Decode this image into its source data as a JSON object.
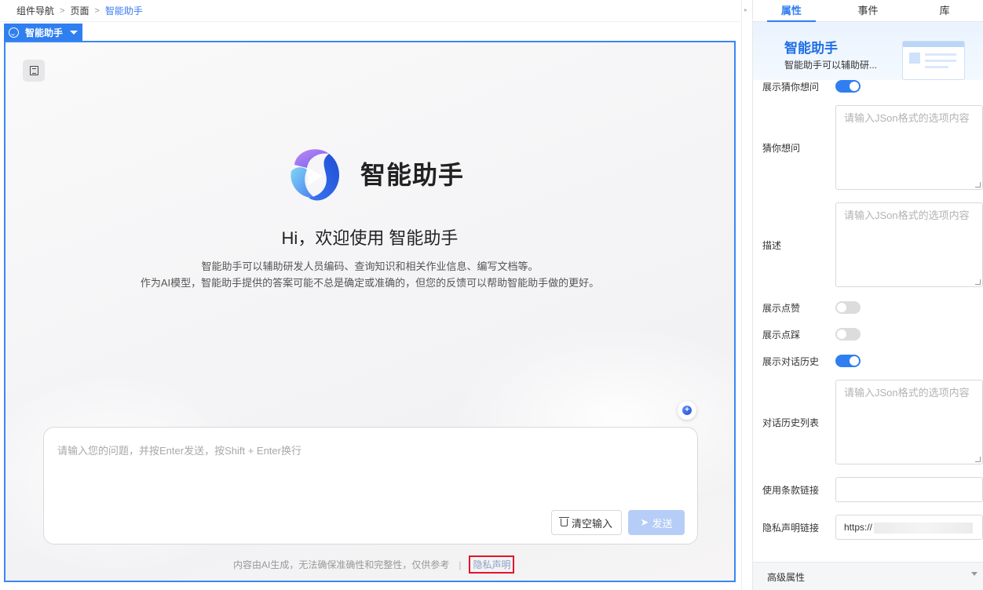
{
  "breadcrumb": {
    "items": [
      "组件导航",
      "页面"
    ],
    "current": "智能助手"
  },
  "component_tag": {
    "label": "智能助手",
    "icon": "smile-icon"
  },
  "assistant": {
    "name": "智能助手",
    "welcome": "Hi，欢迎使用 智能助手",
    "desc_line1": "智能助手可以辅助研发人员编码、查询知识和相关作业信息、编写文档等。",
    "desc_line2": "作为AI模型，智能助手提供的答案可能不总是确定或准确的，但您的反馈可以帮助智能助手做的更好。",
    "input_placeholder": "请输入您的问题，并按Enter发送，按Shift + Enter换行",
    "clear_label": "清空输入",
    "send_label": "发送",
    "footer_note": "内容由AI生成，无法确保准确性和完整性，仅供参考",
    "footer_sep": "|",
    "privacy_label": "隐私声明"
  },
  "panel": {
    "tabs": [
      "属性",
      "事件",
      "库"
    ],
    "active_tab": "属性",
    "hero_title": "智能助手",
    "hero_subtitle": "智能助手可以辅助研...",
    "fields": {
      "show_guess": {
        "label": "展示猜你想问",
        "on": true
      },
      "guess": {
        "label": "猜你想问",
        "placeholder": "请输入JSon格式的选项内容"
      },
      "desc": {
        "label": "描述",
        "placeholder": "请输入JSon格式的选项内容"
      },
      "show_like": {
        "label": "展示点赞",
        "on": false
      },
      "show_dislike": {
        "label": "展示点踩",
        "on": false
      },
      "show_history": {
        "label": "展示对话历史",
        "on": true
      },
      "history_list": {
        "label": "对话历史列表",
        "placeholder": "请输入JSon格式的选项内容"
      },
      "terms_link": {
        "label": "使用条款链接",
        "value": ""
      },
      "privacy_link": {
        "label": "隐私声明链接",
        "value": "https://"
      }
    },
    "advanced_label": "高级属性"
  },
  "colors": {
    "accent": "#2f7ff0",
    "highlight_border": "#e0162b",
    "send_disabled": "#b6cdf7"
  }
}
